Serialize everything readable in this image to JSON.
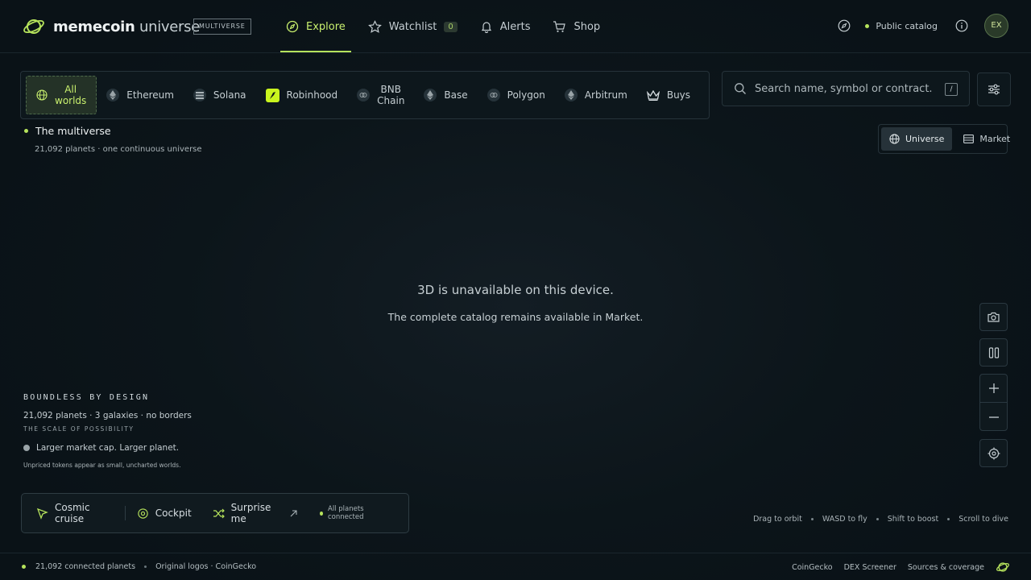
{
  "header": {
    "brand_bold": "memecoin",
    "brand_light": "universe",
    "tag": "MULTIVERSE",
    "nav": [
      {
        "label": "Explore",
        "icon": "compass-icon"
      },
      {
        "label": "Watchlist",
        "icon": "star-icon",
        "badge": "0"
      },
      {
        "label": "Alerts",
        "icon": "bell-icon"
      },
      {
        "label": "Shop",
        "icon": "cart-icon"
      }
    ],
    "catalog_label": "Public catalog",
    "avatar_initials": "EX"
  },
  "chains": [
    {
      "label": "All worlds",
      "line1": "All",
      "line2": "worlds"
    },
    {
      "label": "Ethereum"
    },
    {
      "label": "Solana"
    },
    {
      "label": "Robinhood"
    },
    {
      "label": "BNB Chain",
      "line1": "BNB",
      "line2": "Chain"
    },
    {
      "label": "Base"
    },
    {
      "label": "Polygon"
    },
    {
      "label": "Arbitrum"
    },
    {
      "label": "Buys"
    }
  ],
  "search": {
    "placeholder": "Search name, symbol or contract...",
    "shortcut": "/"
  },
  "multiverse": {
    "title": "The multiverse",
    "subtitle": "21,092 planets · one continuous universe"
  },
  "view_toggle": {
    "universe": "Universe",
    "market": "Market"
  },
  "center": {
    "line1": "3D is unavailable on this device.",
    "line2": "The complete catalog remains available in Market."
  },
  "legend": {
    "heading": "BOUNDLESS BY DESIGN",
    "line": "21,092 planets · 3 galaxies · no borders",
    "caption": "THE SCALE OF POSSIBILITY",
    "dot_label": "Larger market cap. Larger planet.",
    "note": "Unpriced tokens appear as small, uncharted worlds."
  },
  "actions": {
    "cruise": "Cosmic cruise",
    "cockpit": "Cockpit",
    "surprise": "Surprise me",
    "status": "All planets connected"
  },
  "hints": [
    "Drag to orbit",
    "WASD to fly",
    "Shift to boost",
    "Scroll to dive"
  ],
  "footer": {
    "connected": "21,092 connected planets",
    "logos": "Original logos · CoinGecko",
    "links": [
      "CoinGecko",
      "DEX Screener",
      "Sources & coverage"
    ]
  },
  "colors": {
    "accent": "#b6e35c",
    "background": "#0b1419",
    "border": "#26333a"
  }
}
